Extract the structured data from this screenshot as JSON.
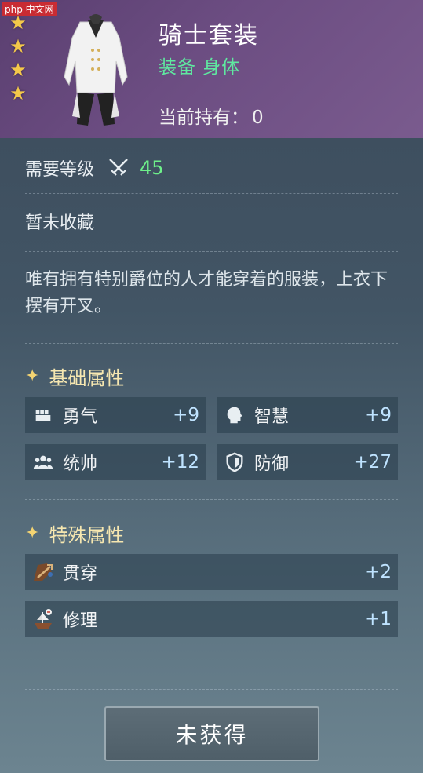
{
  "watermark": "php 中文网",
  "header": {
    "title": "骑士套装",
    "type": "装备 身体",
    "owned_label": "当前持有：",
    "owned_count": "0",
    "stars": 4
  },
  "level": {
    "label": "需要等级",
    "value": "45",
    "icon": "crossed-swords-icon"
  },
  "collection_status": "暂未收藏",
  "description": "唯有拥有特别爵位的人才能穿着的服装，上衣下摆有开叉。",
  "basic_attributes": {
    "title": "基础属性",
    "items": [
      {
        "name": "勇气",
        "value": "+9",
        "icon": "fist-icon"
      },
      {
        "name": "智慧",
        "value": "+9",
        "icon": "head-icon"
      },
      {
        "name": "统帅",
        "value": "+12",
        "icon": "group-icon"
      },
      {
        "name": "防御",
        "value": "+27",
        "icon": "shield-icon"
      }
    ]
  },
  "special_attributes": {
    "title": "特殊属性",
    "items": [
      {
        "name": "贯穿",
        "value": "+2",
        "icon": "pierce-icon"
      },
      {
        "name": "修理",
        "value": "+1",
        "icon": "ship-repair-icon"
      }
    ]
  },
  "action_button": "未获得",
  "colors": {
    "header_bg": "#6c4d82",
    "type_green": "#5fe8a0",
    "level_green": "#6ef08a",
    "value_blue": "#bfe3ff"
  }
}
